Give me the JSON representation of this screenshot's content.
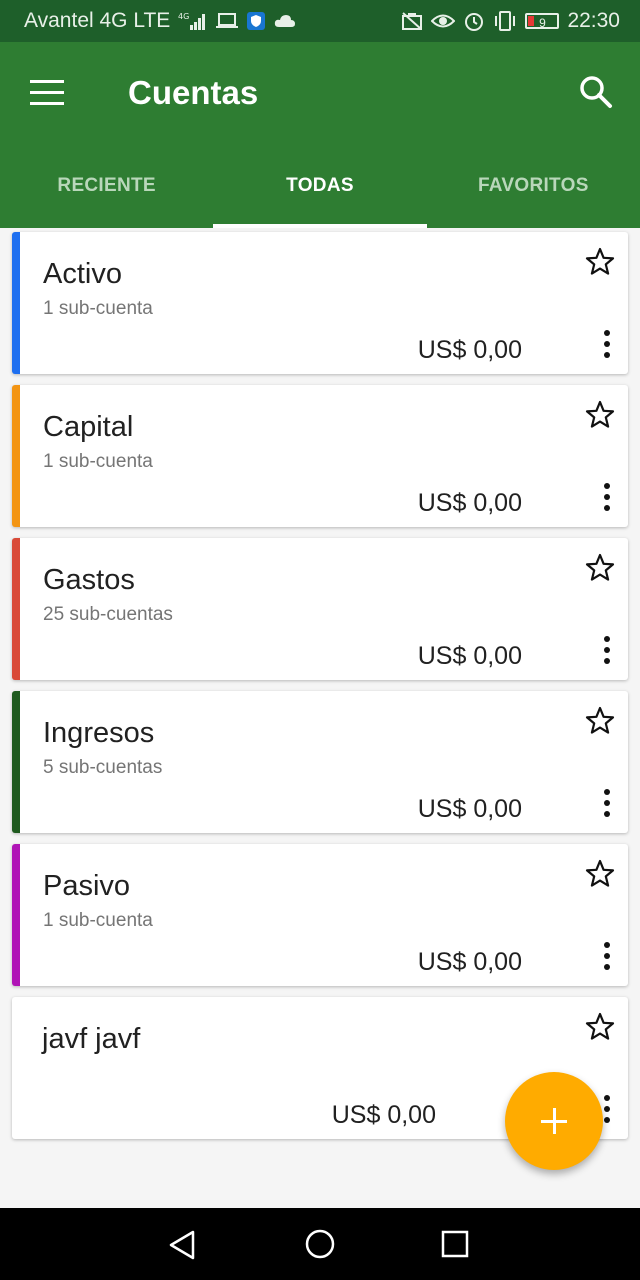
{
  "status_bar": {
    "carrier": "Avantel 4G LTE",
    "network_type": "4G",
    "battery_level": "9",
    "time": "22:30"
  },
  "app_bar": {
    "title": "Cuentas",
    "icons": {
      "menu": "hamburger-menu-icon",
      "search": "search-icon"
    }
  },
  "tabs": [
    {
      "label": "RECIENTE",
      "active": false
    },
    {
      "label": "TODAS",
      "active": true
    },
    {
      "label": "FAVORITOS",
      "active": false
    }
  ],
  "accounts": [
    {
      "name": "Activo",
      "subaccounts": "1 sub-cuenta",
      "balance": "US$ 0,00",
      "color": "#1e6ff0"
    },
    {
      "name": "Capital",
      "subaccounts": "1 sub-cuenta",
      "balance": "US$ 0,00",
      "color": "#f39514"
    },
    {
      "name": "Gastos",
      "subaccounts": "25 sub-cuentas",
      "balance": "US$ 0,00",
      "color": "#d94a38"
    },
    {
      "name": "Ingresos",
      "subaccounts": "5 sub-cuentas",
      "balance": "US$ 0,00",
      "color": "#1e5a1e"
    },
    {
      "name": "Pasivo",
      "subaccounts": "1 sub-cuenta",
      "balance": "US$ 0,00",
      "color": "#b014b6"
    },
    {
      "name": "javf javf",
      "subaccounts": "",
      "balance": "US$ 0,00",
      "color": ""
    }
  ],
  "fab": {
    "icon": "plus-icon",
    "color": "#ffab00"
  },
  "colors": {
    "primary": "#2e7d32",
    "primary_dark": "#1e5f2a",
    "accent": "#ffab00"
  }
}
